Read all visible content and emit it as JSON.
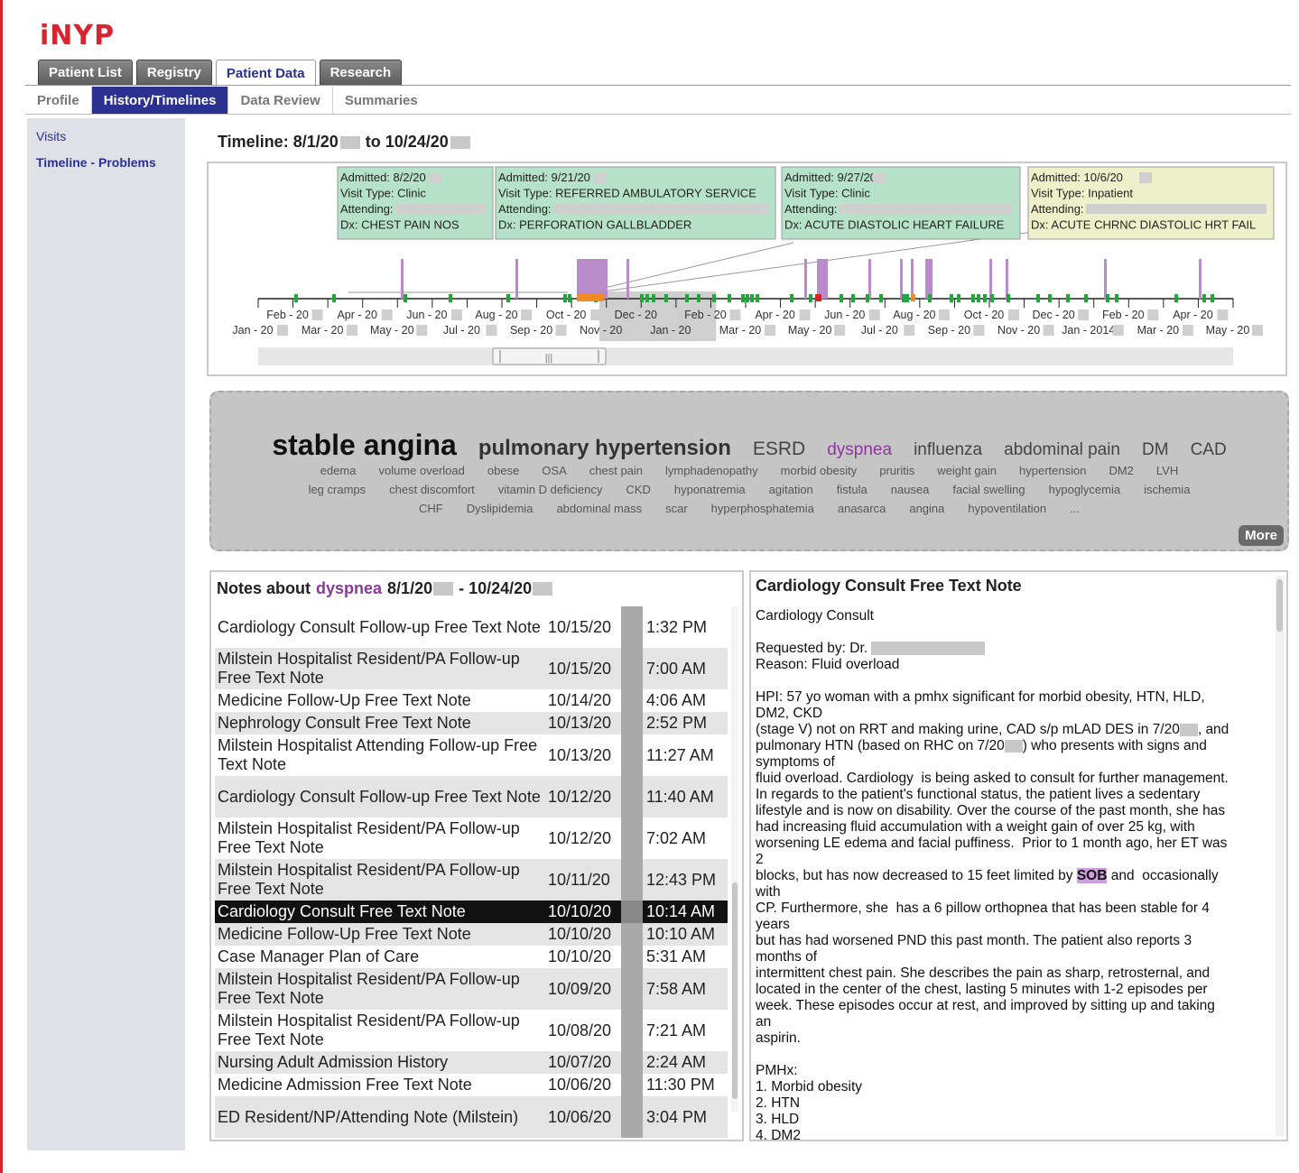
{
  "app": {
    "logo": "iNYP"
  },
  "tabs": [
    "Patient List",
    "Registry",
    "Patient Data",
    "Research"
  ],
  "subtabs": [
    "Profile",
    "History/Timelines",
    "Data Review",
    "Summaries"
  ],
  "sidebar": {
    "items": [
      "Visits",
      "Timeline - Problems"
    ]
  },
  "timeline": {
    "title_prefix": "Timeline: 8/1/20",
    "title_mid": "to 10/24/20",
    "callouts": [
      {
        "admitted": "Admitted: 8/2/20",
        "visit_type": "Visit Type: Clinic",
        "attending": "Attending:",
        "dx": "Dx: CHEST PAIN NOS",
        "color": "#b6e2c9"
      },
      {
        "admitted": "Admitted: 9/21/20",
        "visit_type": "Visit Type: REFERRED AMBULATORY SERVICE",
        "attending": "Attending:",
        "dx": "Dx: PERFORATION GALLBLADDER",
        "color": "#b6e2c9"
      },
      {
        "admitted": "Admitted: 9/27/20",
        "visit_type": "Visit Type: Clinic",
        "attending": "Attending:",
        "dx": "Dx: ACUTE DIASTOLIC HEART FAILURE",
        "color": "#b6e2c9"
      },
      {
        "admitted": "Admitted: 10/6/20",
        "visit_type": "Visit Type: Inpatient",
        "attending": "Attending:",
        "dx": "Dx: ACUTE CHRNC DIASTOLIC HRT FAIL",
        "color": "#eef0c9"
      }
    ],
    "axis_top": [
      "Feb - 20",
      "Apr - 20",
      "Jun - 20",
      "Aug - 20",
      "Oct - 20",
      "Dec - 20",
      "Feb - 20",
      "Apr - 20",
      "Jun - 20",
      "Aug - 20",
      "Oct - 20",
      "Dec - 20",
      "Feb - 20",
      "Apr - 20"
    ],
    "axis_bottom": [
      "Jan - 20",
      "Mar - 20",
      "May - 20",
      "Jul - 20",
      "Sep - 20",
      "Nov - 20",
      "Jan - 20",
      "Mar - 20",
      "May - 20",
      "Jul - 20",
      "Sep - 20",
      "Nov - 20",
      "Jan - 2014",
      "Mar - 20",
      "May - 20"
    ],
    "colors": {
      "visit": "#b98bc9",
      "event": "#22a53a",
      "inpatient": "#f08a24",
      "alert": "#e02020"
    },
    "slider_handle": "|||"
  },
  "cloud": {
    "row1": [
      {
        "t": "stable angina",
        "s": 32,
        "w": "bold",
        "c": "#111"
      },
      {
        "t": "pulmonary hypertension",
        "s": 24,
        "w": "bold",
        "c": "#333"
      },
      {
        "t": "ESRD",
        "s": 21,
        "w": "normal",
        "c": "#444"
      },
      {
        "t": "dyspnea",
        "s": 19,
        "w": "normal",
        "c": "#8a3a99"
      },
      {
        "t": "influenza",
        "s": 19,
        "w": "normal",
        "c": "#444"
      },
      {
        "t": "abdominal pain",
        "s": 19,
        "w": "normal",
        "c": "#444"
      },
      {
        "t": "DM",
        "s": 19,
        "w": "normal",
        "c": "#444"
      },
      {
        "t": "CAD",
        "s": 19,
        "w": "normal",
        "c": "#444"
      }
    ],
    "row2": [
      "edema",
      "volume overload",
      "obese",
      "OSA",
      "chest pain",
      "lymphadenopathy",
      "morbid obesity",
      "pruritis",
      "weight gain",
      "hypertension",
      "DM2",
      "LVH"
    ],
    "row3": [
      "leg cramps",
      "chest discomfort",
      "vitamin D deficiency",
      "CKD",
      "hyponatremia",
      "agitation",
      "fistula",
      "nausea",
      "facial swelling",
      "hypoglycemia",
      "ischemia"
    ],
    "row4": [
      "CHF",
      "Dyslipidemia",
      "abdominal mass",
      "scar",
      "hyperphosphatemia",
      "anasarca",
      "angina",
      "hypoventilation",
      "..."
    ],
    "more_label": "More"
  },
  "notes": {
    "header_prefix": "Notes about",
    "keyword": "dyspnea",
    "range_start": "8/1/20",
    "range_mid": "- 10/24/20",
    "rows": [
      {
        "title": "Cardiology Consult Follow-up Free Text Note",
        "date": "10/15/20",
        "time": "1:32 PM",
        "h": 46
      },
      {
        "title": "Milstein Hospitalist Resident/PA Follow-up Free Text Note",
        "date": "10/15/20",
        "time": "7:00 AM",
        "h": 46
      },
      {
        "title": "Medicine Follow-Up Free Text Note",
        "date": "10/14/20",
        "time": "4:06 AM",
        "h": 25
      },
      {
        "title": "Nephrology Consult Free Text Note",
        "date": "10/13/20",
        "time": "2:52 PM",
        "h": 25
      },
      {
        "title": "Milstein Hospitalist Attending Follow-up Free Text Note",
        "date": "10/13/20",
        "time": "11:27 AM",
        "h": 46
      },
      {
        "title": "Cardiology Consult Follow-up Free Text Note",
        "date": "10/12/20",
        "time": "11:40 AM",
        "h": 46
      },
      {
        "title": "Milstein Hospitalist Resident/PA Follow-up Free Text Note",
        "date": "10/12/20",
        "time": "7:02 AM",
        "h": 46
      },
      {
        "title": "Milstein Hospitalist Resident/PA Follow-up Free Text Note",
        "date": "10/11/20",
        "time": "12:43 PM",
        "h": 46
      },
      {
        "title": "Cardiology Consult Free Text Note",
        "date": "10/10/20",
        "time": "10:14 AM",
        "h": 25,
        "selected": true
      },
      {
        "title": "Medicine Follow-Up Free Text Note",
        "date": "10/10/20",
        "time": "10:10 AM",
        "h": 25
      },
      {
        "title": "Case Manager Plan of Care",
        "date": "10/10/20",
        "time": "5:31 AM",
        "h": 25
      },
      {
        "title": "Milstein Hospitalist Resident/PA Follow-up Free Text Note",
        "date": "10/09/20",
        "time": "7:58 AM",
        "h": 46
      },
      {
        "title": "Milstein Hospitalist Resident/PA Follow-up Free Text Note",
        "date": "10/08/20",
        "time": "7:21 AM",
        "h": 46
      },
      {
        "title": "Nursing Adult Admission History",
        "date": "10/07/20",
        "time": "2:24 AM",
        "h": 25
      },
      {
        "title": "Medicine Admission Free Text Note",
        "date": "10/06/20",
        "time": "11:30 PM",
        "h": 25
      },
      {
        "title": "ED Resident/NP/Attending Note (Milstein)",
        "date": "10/06/20",
        "time": "3:04 PM",
        "h": 46
      }
    ]
  },
  "detail": {
    "title": "Cardiology Consult Free Text Note",
    "p1": "Cardiology Consult",
    "requested_by": "Requested by: Dr.",
    "reason": "Reason: Fluid overload",
    "hpi_a": "HPI: 57 yo woman with a pmhx significant for morbid obesity, HTN, HLD,\nDM2, CKD\n(stage V) not on RRT and making urine, CAD s/p mLAD DES in 7/20",
    "hpi_b": ", and\npulmonary HTN (based on RHC on 7/20",
    "hpi_c": ") who presents with signs and\nsymptoms of\nfluid overload. Cardiology  is being asked to consult for further management.\nIn regards to the patient's functional status, the patient lives a sedentary\nlifestyle and is now on disability. Over the course of the past month, she has\nhad increasing fluid accumulation with a weight gain of over 25 kg, with\nworsening LE edema and facial puffiness.  Prior to 1 month ago, her ET was\n2\nblocks, but has now decreased to 15 feet limited by ",
    "highlight": "SOB",
    "hpi_d": " and  occasionally\nwith\nCP. Furthermore, she  has a 6 pillow orthopnea that has been stable for 4\nyears\nbut has had worsened PND this past month. The patient also reports 3\nmonths of\nintermittent chest pain. She describes the pain as sharp, retrosternal, and\nlocated in the center of the chest, lasting 5 minutes with 1-2 episodes per\nweek. These episodes occur at rest, and improved by sitting up and taking\nan\naspirin.\n\nPMHx:\n1. Morbid obesity\n2. HTN\n3. HLD\n4. DM2"
  }
}
